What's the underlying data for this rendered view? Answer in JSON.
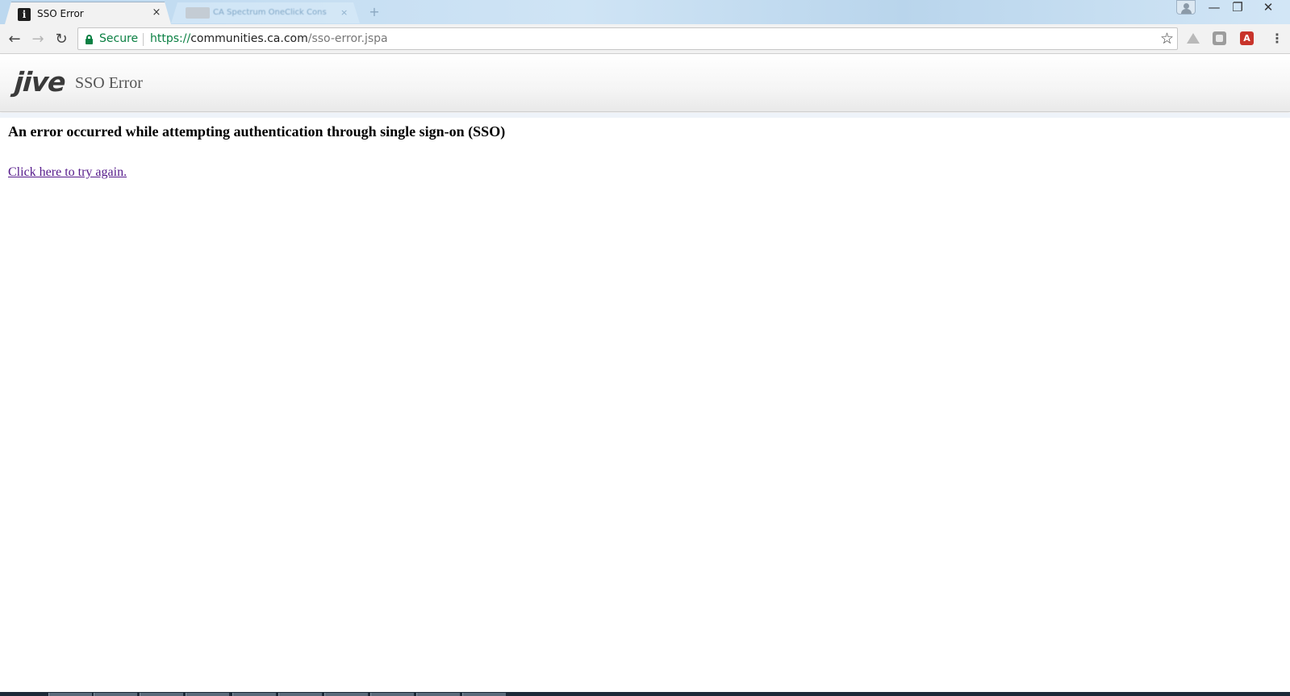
{
  "browser": {
    "active_tab": {
      "title": "SSO Error",
      "favicon": "jive-info-favicon",
      "close_glyph": "×"
    },
    "inactive_tab": {
      "title": "CA Spectrum OneClick Cons",
      "close_glyph": "×"
    },
    "new_tab_glyph": "+",
    "window_controls": {
      "minimize": "—",
      "maximize": "❐",
      "close": "✕"
    },
    "nav": {
      "back": "←",
      "forward": "→",
      "reload": "↻"
    },
    "omnibox": {
      "security_label": "Secure",
      "url_scheme": "https://",
      "url_host": "communities.ca.com",
      "url_path": "/sso-error.jspa"
    },
    "bookmark_glyph": "☆",
    "extensions": [
      {
        "name": "google-drive-icon",
        "glyph": ""
      },
      {
        "name": "extension-shield-icon",
        "glyph": ""
      },
      {
        "name": "acrobat-icon",
        "glyph": "A"
      }
    ],
    "menu_glyph": "⋮",
    "colors": {
      "secure": "#0b8043",
      "visited_link": "#551a8b"
    }
  },
  "page": {
    "logo_text": "jive",
    "header_title": "SSO Error",
    "error_heading": "An error occurred while attempting authentication through single sign-on (SSO)",
    "retry_link": "Click here to try again."
  }
}
